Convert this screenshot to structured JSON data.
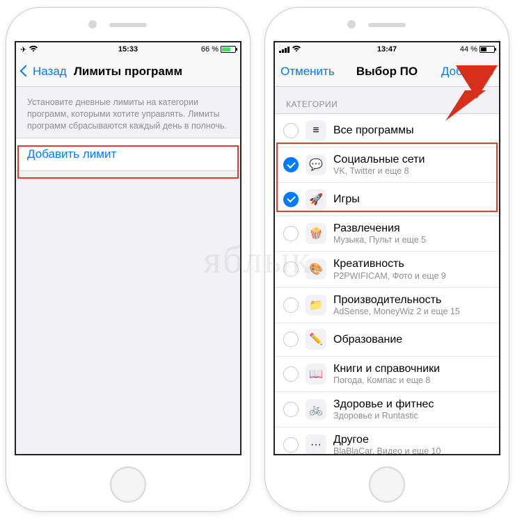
{
  "watermark": "яблык",
  "left": {
    "statusbar": {
      "time": "15:33",
      "battery_pct": "66 %"
    },
    "nav": {
      "back": "Назад",
      "title": "Лимиты программ"
    },
    "description": "Установите дневные лимиты на категории программ, которыми хотите управлять. Лимиты программ сбрасываются каждый день в полночь.",
    "add_limit": "Добавить лимит"
  },
  "right": {
    "statusbar": {
      "time": "13:47",
      "battery_pct": "44 %"
    },
    "nav": {
      "cancel": "Отменить",
      "title": "Выбор ПО",
      "add": "Добавить"
    },
    "section_header": "КАТЕГОРИИ",
    "categories": [
      {
        "title": "Все программы",
        "sub": "",
        "checked": false,
        "icon": "≡"
      },
      {
        "title": "Социальные сети",
        "sub": "VK, Twitter и еще 8",
        "checked": true,
        "icon": "💬"
      },
      {
        "title": "Игры",
        "sub": "",
        "checked": true,
        "icon": "🚀"
      },
      {
        "title": "Развлечения",
        "sub": "Музыка, Пульт и еще 5",
        "checked": false,
        "icon": "🍿"
      },
      {
        "title": "Креативность",
        "sub": "P2PWIFICAM, Фото и еще 9",
        "checked": false,
        "icon": "🎨"
      },
      {
        "title": "Производительность",
        "sub": "AdSense, MoneyWiz 2 и еще 15",
        "checked": false,
        "icon": "📁"
      },
      {
        "title": "Образование",
        "sub": "",
        "checked": false,
        "icon": "✏️"
      },
      {
        "title": "Книги и справочники",
        "sub": "Погода, Компас и еще 8",
        "checked": false,
        "icon": "📖"
      },
      {
        "title": "Здоровье и фитнес",
        "sub": "Здоровье и Runtastic",
        "checked": false,
        "icon": "🚲"
      },
      {
        "title": "Другое",
        "sub": "BlaBlaCar, Видео и еще 10",
        "checked": false,
        "icon": "···"
      }
    ]
  }
}
